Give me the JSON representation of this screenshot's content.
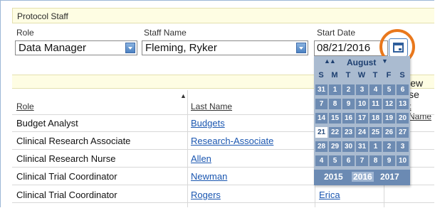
{
  "panel": {
    "title": "Protocol Staff"
  },
  "form": {
    "role_label": "Role",
    "staff_label": "Staff Name",
    "start_label": "Start Date",
    "role_value": "Data Manager",
    "staff_value": "Fleming, Ryker",
    "start_value": "08/21/2016"
  },
  "toolbar": {
    "view_users": "View Use"
  },
  "table": {
    "headers": {
      "role": "Role",
      "last_name": "Last Name",
      "first_name": "t Name"
    },
    "rows": [
      {
        "role": "Budget Analyst",
        "last": "Budgets"
      },
      {
        "role": "Clinical Research Associate",
        "last": "Research-Associate"
      },
      {
        "role": "Clinical Research Nurse",
        "last": "Allen"
      },
      {
        "role": "Clinical Trial Coordinator",
        "last": "Newman"
      },
      {
        "role": "Clinical Trial Coordinator",
        "last": "Rogers",
        "first": "Erica"
      }
    ]
  },
  "calendar": {
    "month": "August",
    "prev_icon": "double-up-arrow",
    "next_icon": "down-arrow",
    "dow": [
      "S",
      "M",
      "T",
      "W",
      "T",
      "F",
      "S"
    ],
    "weeks": [
      [
        "31",
        "1",
        "2",
        "3",
        "4",
        "5",
        "6"
      ],
      [
        "7",
        "8",
        "9",
        "10",
        "11",
        "12",
        "13"
      ],
      [
        "14",
        "15",
        "16",
        "17",
        "18",
        "19",
        "20"
      ],
      [
        "21",
        "22",
        "23",
        "24",
        "25",
        "26",
        "27"
      ],
      [
        "28",
        "29",
        "30",
        "31",
        "1",
        "2",
        "3"
      ],
      [
        "4",
        "5",
        "6",
        "7",
        "8",
        "9",
        "10"
      ]
    ],
    "selected": "21",
    "years": [
      "2015",
      "2016",
      "2017"
    ],
    "current_year": "2016"
  },
  "colors": {
    "accent_ring": "#e9781c",
    "link": "#1a56b0",
    "calendar_bg": "#aabbd0"
  }
}
